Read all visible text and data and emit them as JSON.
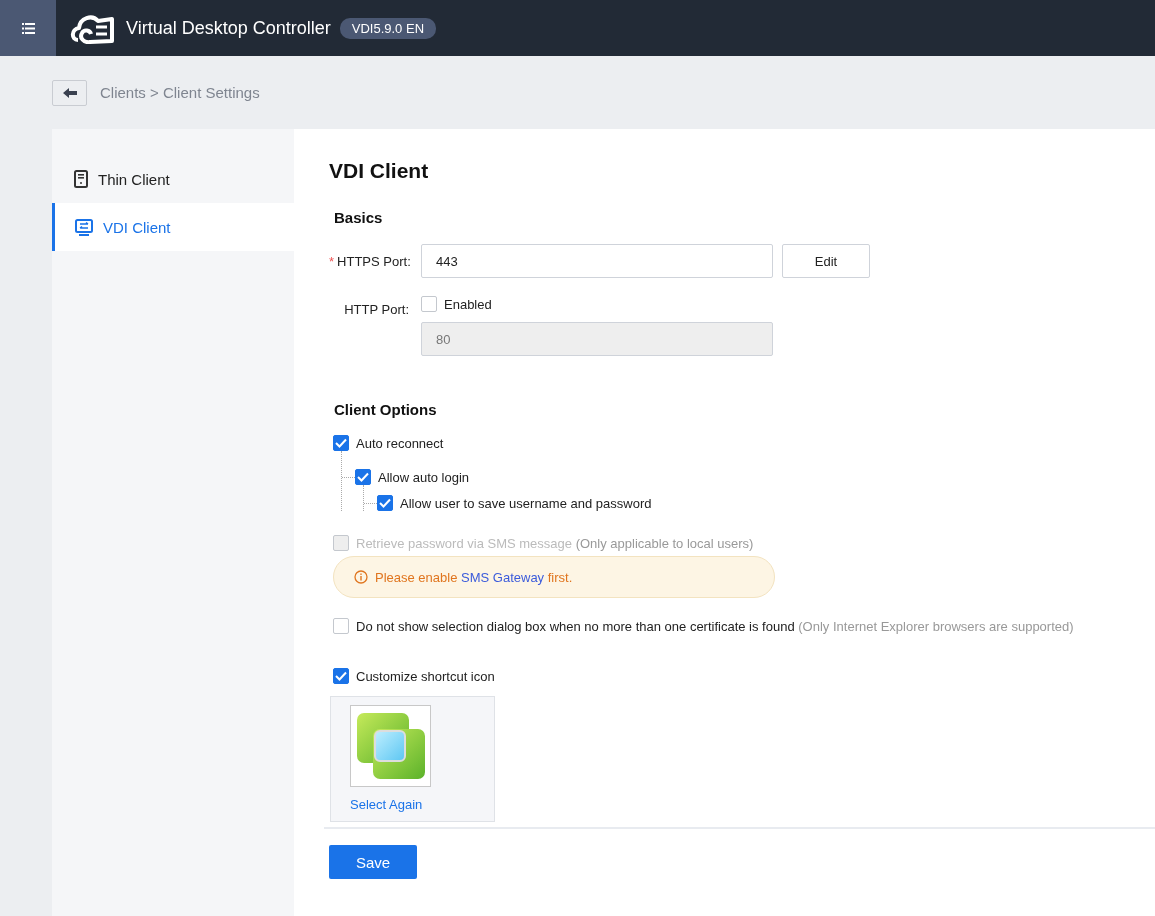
{
  "header": {
    "title": "Virtual Desktop Controller",
    "version": "VDI5.9.0 EN"
  },
  "breadcrumb": {
    "path": "Clients > Client Settings"
  },
  "sidebar": {
    "items": [
      {
        "label": "Thin Client",
        "kind": "thin",
        "selected": false
      },
      {
        "label": "VDI Client",
        "kind": "vdi",
        "selected": true
      }
    ]
  },
  "page_title": "VDI Client",
  "basics": {
    "title": "Basics",
    "https_port": {
      "label": "HTTPS Port:",
      "required_mark": "*",
      "value": "443",
      "button": "Edit"
    },
    "http_port": {
      "label": "HTTP Port:",
      "checkbox": "Enabled",
      "checked": false,
      "value": "80",
      "disabled": true
    }
  },
  "client_options": {
    "title": "Client Options",
    "items": [
      {
        "label": "Auto reconnect",
        "checked": true,
        "disabled": false,
        "children": [
          {
            "label": "Allow auto login",
            "checked": true,
            "disabled": false,
            "children": [
              {
                "label": "Allow user to save username and password",
                "checked": true,
                "disabled": false
              }
            ]
          }
        ]
      },
      {
        "label": "Retrieve password via SMS message",
        "note": "(Only applicable to local users)",
        "checked": false,
        "disabled": true,
        "warning": {
          "before": "Please enable",
          "link": "SMS Gateway",
          "after": "first."
        }
      },
      {
        "label": "Do not show selection dialog box when no more than one certificate is found",
        "note": "(Only Internet Explorer browsers are supported)",
        "checked": false,
        "disabled": false
      },
      {
        "label": "Customize shortcut icon",
        "checked": true,
        "disabled": false,
        "picker": {
          "link": "Select Again"
        }
      }
    ]
  },
  "save_button": "Save"
}
